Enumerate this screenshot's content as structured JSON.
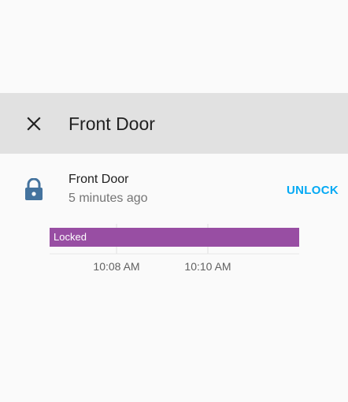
{
  "dialog": {
    "title": "Front Door"
  },
  "entity": {
    "name": "Front Door",
    "last_changed": "5 minutes ago",
    "action_label": "UNLOCK",
    "icon": "lock-icon",
    "icon_color": "#44739e"
  },
  "history": {
    "state_label": "Locked",
    "state_color": "#984ea3",
    "ticks": [
      "10:08 AM",
      "10:10 AM"
    ]
  },
  "colors": {
    "accent": "#03a9f4",
    "header_bg": "#e1e1e1"
  }
}
